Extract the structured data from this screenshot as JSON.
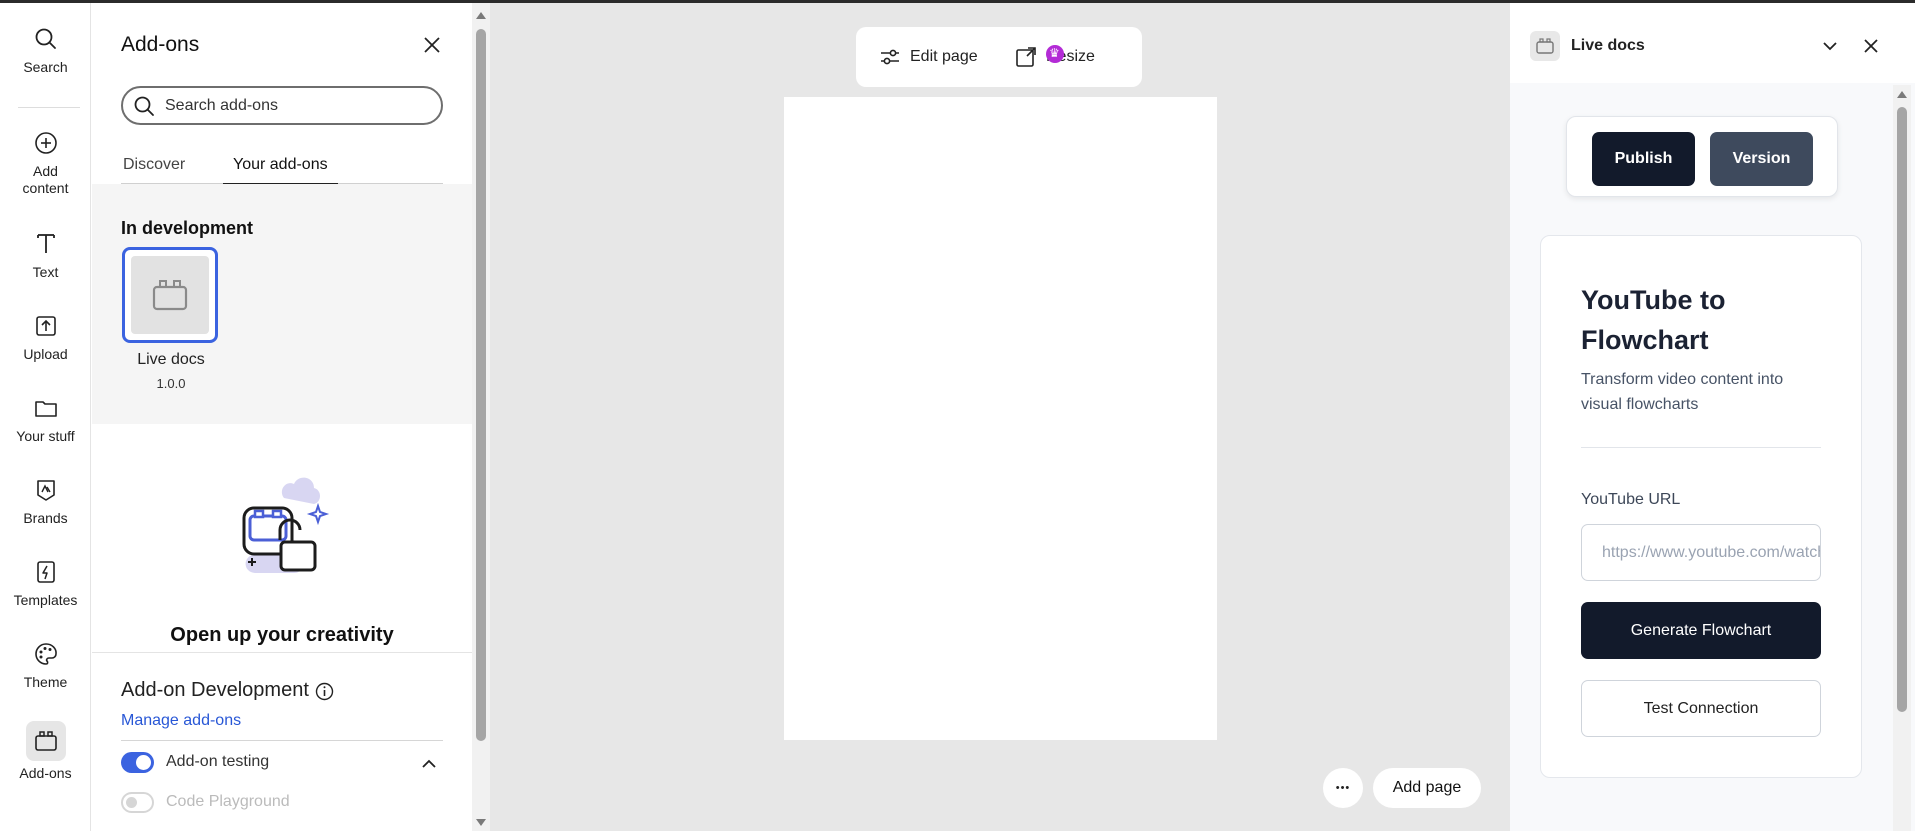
{
  "rail": {
    "items": [
      {
        "label": "Search",
        "icon": "search-icon"
      },
      {
        "label": "Add content",
        "icon": "plus-circle-icon"
      },
      {
        "label": "Text",
        "icon": "text-icon"
      },
      {
        "label": "Upload",
        "icon": "upload-icon"
      },
      {
        "label": "Your stuff",
        "icon": "folder-icon"
      },
      {
        "label": "Brands",
        "icon": "brand-icon"
      },
      {
        "label": "Templates",
        "icon": "templates-icon"
      },
      {
        "label": "Theme",
        "icon": "palette-icon"
      },
      {
        "label": "Add-ons",
        "icon": "addons-icon",
        "active": true
      }
    ]
  },
  "addons_panel": {
    "title": "Add-ons",
    "search_placeholder": "Search add-ons",
    "tabs": [
      "Discover",
      "Your add-ons"
    ],
    "active_tab": "Your add-ons",
    "in_development": {
      "heading": "In development",
      "addon": {
        "name": "Live docs",
        "version": "1.0.0"
      }
    },
    "promo_heading": "Open up your creativity",
    "development": {
      "title": "Add-on Development",
      "manage_link": "Manage add-ons",
      "toggles": [
        {
          "label": "Add-on testing",
          "on": true
        },
        {
          "label": "Code Playground",
          "on": false,
          "disabled": true
        }
      ]
    }
  },
  "canvas": {
    "toolbar": {
      "edit_page": "Edit page",
      "resize": "Resize"
    },
    "more": "•••",
    "add_page": "Add page"
  },
  "live_docs": {
    "header_title": "Live docs",
    "publish": "Publish",
    "version": "Version",
    "card": {
      "title": "YouTube to Flowchart",
      "subtitle": "Transform video content into visual flowcharts",
      "url_label": "YouTube URL",
      "url_placeholder": "https://www.youtube.com/watch?v=...",
      "generate": "Generate Flowchart",
      "test": "Test Connection"
    }
  },
  "colors": {
    "accent_blue": "#3b63e0",
    "dark_navy": "#121a2b",
    "slate": "#3e4a5d",
    "premium_purple": "#b32bd6"
  }
}
